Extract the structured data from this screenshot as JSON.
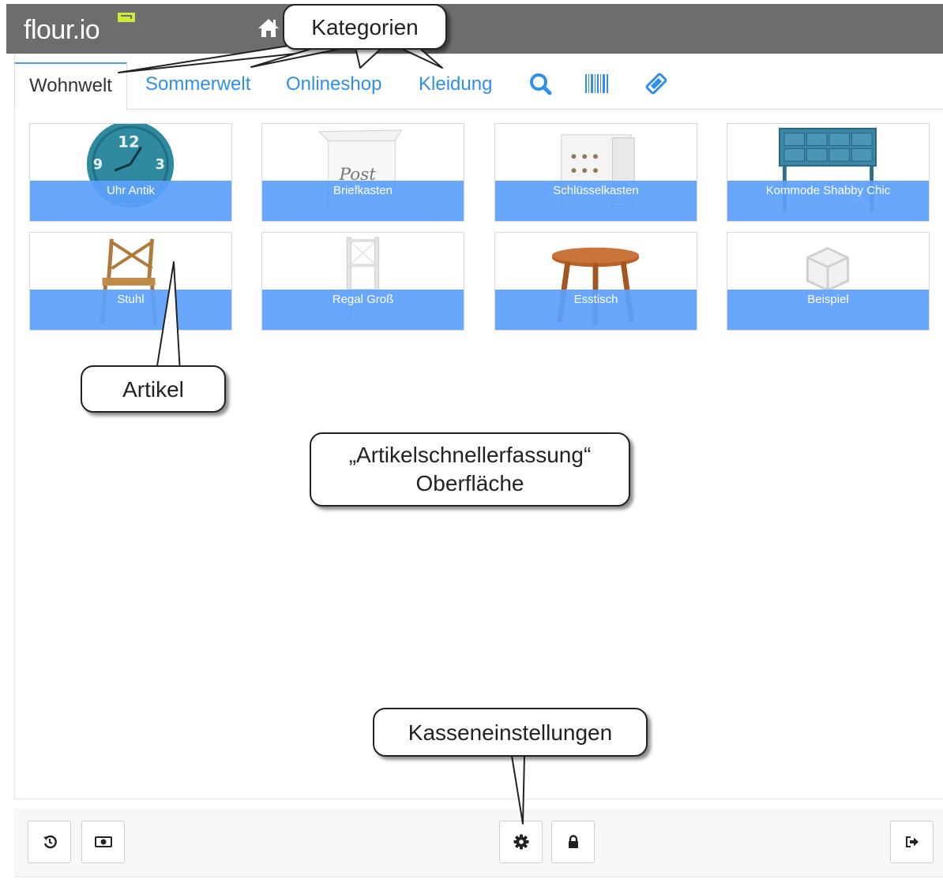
{
  "app": {
    "logo_text": "flour.io"
  },
  "header": {
    "home_icon": "home-icon"
  },
  "tabs": [
    {
      "label": "Wohnwelt",
      "active": true
    },
    {
      "label": "Sommerwelt",
      "active": false
    },
    {
      "label": "Onlineshop",
      "active": false
    },
    {
      "label": "Kleidung",
      "active": false
    }
  ],
  "toolbar": {
    "icons": [
      "search-icon",
      "barcode-icon",
      "ticket-icon"
    ]
  },
  "articles": [
    {
      "label": "Uhr Antik",
      "image": "clock-image"
    },
    {
      "label": "Briefkasten",
      "image": "mailbox-image"
    },
    {
      "label": "Schlüsselkasten",
      "image": "key-cabinet-image"
    },
    {
      "label": "Kommode Shabby Chic",
      "image": "dresser-image"
    },
    {
      "label": "Stuhl",
      "image": "chair-image"
    },
    {
      "label": "Regal Groß",
      "image": "shelf-image"
    },
    {
      "label": "Esstisch",
      "image": "stool-table-image"
    },
    {
      "label": "Beispiel",
      "image": "placeholder-box-image"
    }
  ],
  "footer": {
    "left_icons": [
      "history-icon",
      "cash-icon"
    ],
    "center_icons": [
      "gear-icon",
      "lock-icon"
    ],
    "right_icons": [
      "logout-icon"
    ]
  },
  "callouts": {
    "categories": "Kategorien",
    "articles": "Artikel",
    "surface_line1": "„Artikelschnellerfassung“",
    "surface_line2": "Oberfläche",
    "settings": "Kasseneinstellungen"
  },
  "colors": {
    "header_bg": "#6d6d6d",
    "accent_blue": "#2f8fea",
    "tile_bar": "#5ca0fc",
    "logo_green": "#cdea3a"
  }
}
